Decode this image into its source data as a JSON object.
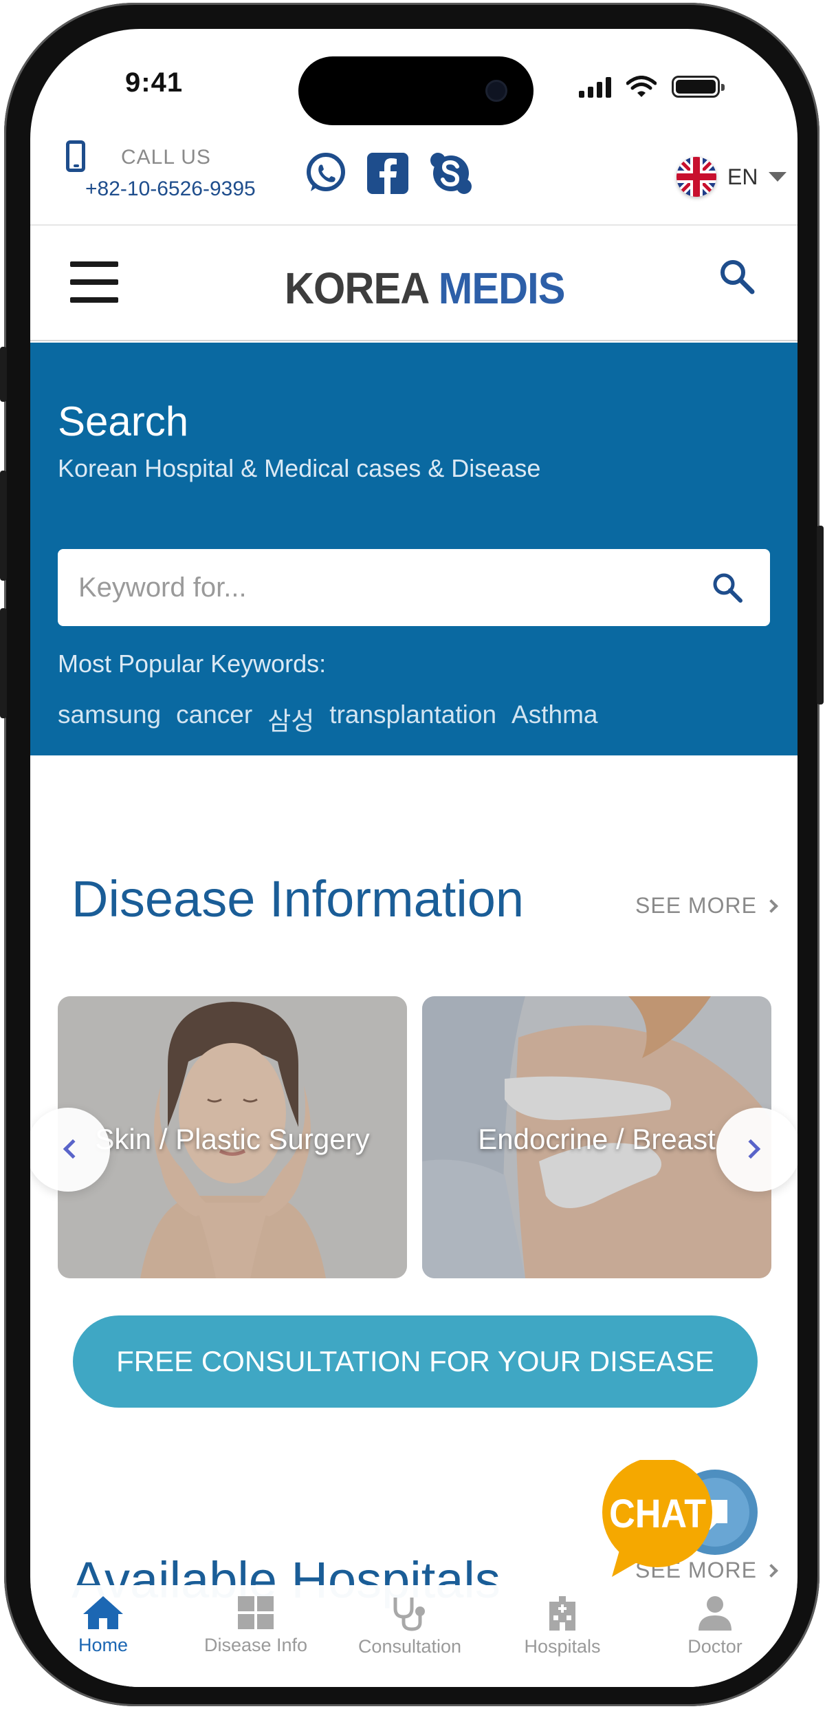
{
  "status_bar": {
    "time": "9:41"
  },
  "contact": {
    "call_label": "CALL US",
    "phone_number": "+82-10-6526-9395",
    "language": "EN",
    "social": [
      "whatsapp-icon",
      "facebook-icon",
      "skype-icon"
    ]
  },
  "header": {
    "logo_part1": "K",
    "logo_part2": "O",
    "logo_part3": "REA ",
    "logo_part4": "MEDIS"
  },
  "search": {
    "title": "Search",
    "subtitle": "Korean Hospital & Medical cases & Disease",
    "placeholder": "Keyword for...",
    "popular_label": "Most Popular Keywords:",
    "keywords": [
      "samsung",
      "cancer",
      "삼성",
      "transplantation",
      "Asthma"
    ]
  },
  "disease_info": {
    "title": "Disease Information",
    "see_more": "SEE MORE",
    "cards": [
      {
        "label": "Skin / Plastic Surgery"
      },
      {
        "label": "Endocrine / Breast"
      }
    ],
    "cta": "FREE CONSULTATION FOR YOUR DISEASE"
  },
  "hospitals": {
    "title": "Available Hospitals",
    "see_more": "SEE MORE"
  },
  "chat": {
    "label": "CHAT"
  },
  "bottom_nav": [
    {
      "label": "Home",
      "active": true
    },
    {
      "label": "Disease Info"
    },
    {
      "label": "Consultation"
    },
    {
      "label": "Hospitals"
    },
    {
      "label": "Doctor"
    }
  ],
  "colors": {
    "brand_blue": "#0a69a1",
    "title_blue": "#1a5d97",
    "cta_teal": "#3fa7c4",
    "chat_orange": "#f5a800"
  }
}
